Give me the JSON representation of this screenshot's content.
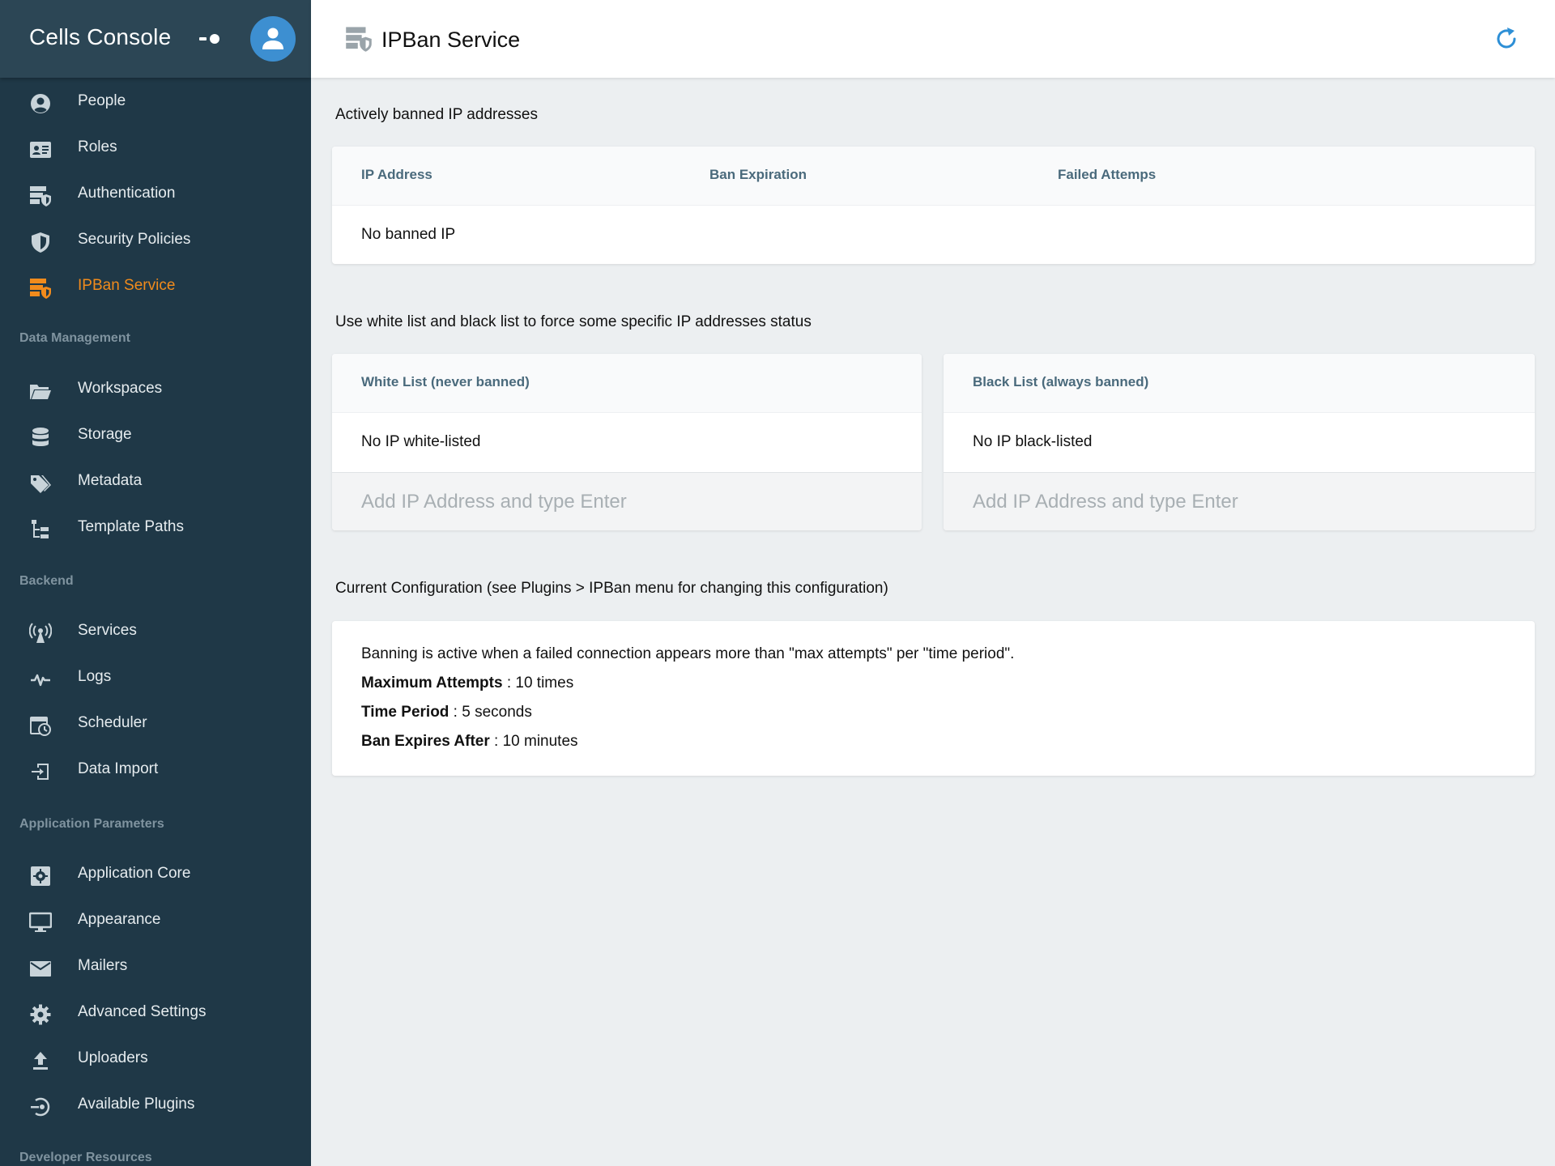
{
  "sidebar": {
    "title": "Cells Console",
    "items": [
      {
        "label": "People",
        "icon": "person-circle-icon"
      },
      {
        "label": "Roles",
        "icon": "id-card-icon"
      },
      {
        "label": "Authentication",
        "icon": "server-shield-icon"
      },
      {
        "label": "Security Policies",
        "icon": "shield-icon"
      },
      {
        "label": "IPBan Service",
        "icon": "server-shield-icon",
        "active": true
      }
    ],
    "sections": [
      {
        "title": "Data Management",
        "items": [
          {
            "label": "Workspaces",
            "icon": "folder-open-icon"
          },
          {
            "label": "Storage",
            "icon": "database-icon"
          },
          {
            "label": "Metadata",
            "icon": "tags-icon"
          },
          {
            "label": "Template Paths",
            "icon": "file-tree-icon"
          }
        ]
      },
      {
        "title": "Backend",
        "items": [
          {
            "label": "Services",
            "icon": "antenna-icon"
          },
          {
            "label": "Logs",
            "icon": "pulse-icon"
          },
          {
            "label": "Scheduler",
            "icon": "calendar-clock-icon"
          },
          {
            "label": "Data Import",
            "icon": "import-icon"
          }
        ]
      },
      {
        "title": "Application Parameters",
        "items": [
          {
            "label": "Application Core",
            "icon": "gear-box-icon"
          },
          {
            "label": "Appearance",
            "icon": "monitor-icon"
          },
          {
            "label": "Mailers",
            "icon": "mail-icon"
          },
          {
            "label": "Advanced Settings",
            "icon": "gear-icon"
          },
          {
            "label": "Uploaders",
            "icon": "upload-icon"
          },
          {
            "label": "Available Plugins",
            "icon": "plugin-icon"
          }
        ]
      },
      {
        "title": "Developer Resources",
        "items": []
      }
    ]
  },
  "header": {
    "title": "IPBan Service",
    "icon": "server-shield-icon",
    "refresh_icon": "refresh-icon"
  },
  "banned": {
    "section_label": "Actively banned IP addresses",
    "columns": [
      "IP Address",
      "Ban Expiration",
      "Failed Attemps"
    ],
    "empty_text": "No banned IP"
  },
  "lists": {
    "section_label": "Use white list and black list to force some specific IP addresses status",
    "white": {
      "title": "White List (never banned)",
      "empty_text": "No IP white-listed",
      "placeholder": "Add IP Address and type Enter"
    },
    "black": {
      "title": "Black List (always banned)",
      "empty_text": "No IP black-listed",
      "placeholder": "Add IP Address and type Enter"
    }
  },
  "config": {
    "section_label": "Current Configuration (see Plugins > IPBan menu for changing this configuration)",
    "description": "Banning is active when a failed connection appears more than \"max attempts\" per \"time period\".",
    "max_attempts_label": "Maximum Attempts",
    "max_attempts_value": " : 10 times",
    "time_period_label": "Time Period",
    "time_period_value": " : 5 seconds",
    "ban_expires_label": "Ban Expires After",
    "ban_expires_value": " : 10 minutes"
  },
  "colors": {
    "sidebar_bg": "#1f3847",
    "sidebar_header_bg": "#2c4655",
    "active": "#f18b1c",
    "accent": "#3d8fd1",
    "column_header": "#4a6a7c"
  }
}
